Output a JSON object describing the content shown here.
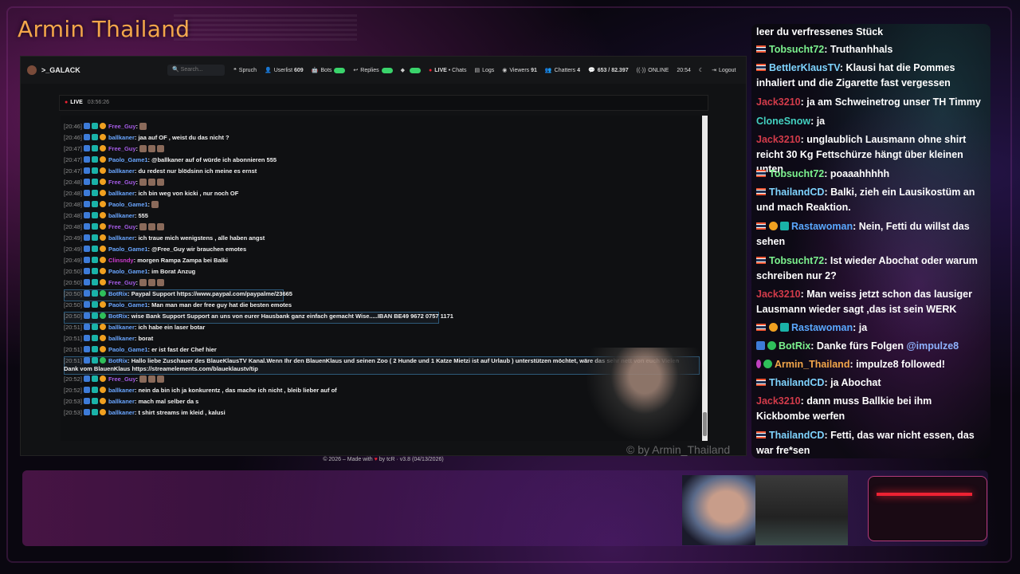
{
  "overlay": {
    "title": "Armin Thailand",
    "watermark": "© by Armin_Thailand"
  },
  "navbar": {
    "brand": ">_GALACK",
    "search_placeholder": "Search...",
    "items": {
      "spruch": "Spruch",
      "userlist": "Userlist",
      "userlist_count": "609",
      "bots": "Bots",
      "replies": "Replies",
      "live": "LIVE",
      "chats": "• Chats",
      "logs": "Logs",
      "viewers": "Viewers",
      "viewers_count": "91",
      "chatters": "Chatters",
      "chatters_count": "4",
      "messages": "653 / 82.397",
      "online": "ONLINE",
      "time": "20:54",
      "logout": "Logout"
    }
  },
  "live_bar": {
    "label": "LIVE",
    "uptime": "03:56:26"
  },
  "chatlog": [
    {
      "ts": "[20:46]",
      "user": "Free_Guy",
      "color": "purple",
      "text": ":",
      "emotes": 1
    },
    {
      "ts": "[20:46]",
      "user": "ballkaner",
      "color": "blue",
      "text": ": jaa auf OF , weist du das nicht ?"
    },
    {
      "ts": "[20:47]",
      "user": "Free_Guy",
      "color": "purple",
      "text": ":",
      "emotes": 3
    },
    {
      "ts": "[20:47]",
      "user": "Paolo_Game1",
      "color": "blue",
      "text": ": @ballkaner auf of würde ich abonnieren 555"
    },
    {
      "ts": "[20:47]",
      "user": "ballkaner",
      "color": "blue",
      "text": ": du redest nur blödsinn ich meine es ernst"
    },
    {
      "ts": "[20:48]",
      "user": "Free_Guy",
      "color": "purple",
      "text": ":",
      "emotes": 3
    },
    {
      "ts": "[20:48]",
      "user": "ballkaner",
      "color": "blue",
      "text": ": ich bin weg von kicki , nur noch OF"
    },
    {
      "ts": "[20:48]",
      "user": "Paolo_Game1",
      "color": "blue",
      "text": ":",
      "emotes": 1
    },
    {
      "ts": "[20:48]",
      "user": "ballkaner",
      "color": "blue",
      "text": ": 555"
    },
    {
      "ts": "[20:48]",
      "user": "Free_Guy",
      "color": "purple",
      "text": ":",
      "emotes": 3
    },
    {
      "ts": "[20:49]",
      "user": "ballkaner",
      "color": "blue",
      "text": ": ich traue mich wenigstens , alle haben angst"
    },
    {
      "ts": "[20:49]",
      "user": "Paolo_Game1",
      "color": "blue",
      "text": ": @Free_Guy wir brauchen emotes"
    },
    {
      "ts": "[20:49]",
      "user": "Clinsndy",
      "color": "pink",
      "text": ": morgen Rampa Zampa bei Balki"
    },
    {
      "ts": "[20:50]",
      "user": "Paolo_Game1",
      "color": "blue",
      "text": ": im Borat Anzug"
    },
    {
      "ts": "[20:50]",
      "user": "Free_Guy",
      "color": "purple",
      "text": ":",
      "emotes": 3
    },
    {
      "ts": "[20:50]",
      "user": "BotRix",
      "color": "blue",
      "text": ": Paypal Support https://www.paypal.com/paypalme/23665",
      "bot": true
    },
    {
      "ts": "[20:50]",
      "user": "Paolo_Game1",
      "color": "blue",
      "text": ": Man man man der free guy hat die besten emotes"
    },
    {
      "ts": "[20:50]",
      "user": "BotRix",
      "color": "blue",
      "text": ": wise Bank Support Support an uns von eurer Hausbank ganz einfach gemacht Wise.....IBAN BE49 9672 0757 1171",
      "bot": true
    },
    {
      "ts": "[20:51]",
      "user": "ballkaner",
      "color": "blue",
      "text": ": ich habe ein laser botar"
    },
    {
      "ts": "[20:51]",
      "user": "ballkaner",
      "color": "blue",
      "text": ": borat"
    },
    {
      "ts": "[20:51]",
      "user": "Paolo_Game1",
      "color": "blue",
      "text": ": er ist fast der Chef hier"
    },
    {
      "ts": "[20:51]",
      "user": "BotRix",
      "color": "blue",
      "text": ": Hallo liebe Zuschauer des BlaueKlausTV Kanal.Wenn Ihr den BlauenKlaus und seinen Zoo ( 2 Hunde und 1 Katze Mietzi ist auf Urlaub ) unterstützen möchtet, wäre das sehr nett von euch Vielen",
      "text2": "Dank vom BlauenKlaus https://streamelements.com/blaueklaustv/tip",
      "bot": true
    },
    {
      "ts": "[20:52]",
      "user": "Free_Guy",
      "color": "purple",
      "text": ":",
      "emotes": 3
    },
    {
      "ts": "[20:52]",
      "user": "ballkaner",
      "color": "blue",
      "text": ": nein da bin ich ja konkurentz , das mache ich nicht , bleib lieber auf of"
    },
    {
      "ts": "[20:53]",
      "user": "ballkaner",
      "color": "blue",
      "text": ": mach mal selber da s"
    },
    {
      "ts": "[20:53]",
      "user": "ballkaner",
      "color": "blue",
      "text": ": t shirt streams im kleid , kalusi"
    }
  ],
  "footer": {
    "pre": "© 2026 – Made with",
    "post": "by tcR · v3.8 (04/13/2026)"
  },
  "side_chat": [
    {
      "user": "",
      "text": "leer du verfressenes Stück"
    },
    {
      "user": "Tobsucht72",
      "color": "green",
      "text": ": Truthanhhals"
    },
    {
      "user": "BettlerKlausTV",
      "color": "cyan",
      "text": ": Klausi hat die Pommes inhaliert und die Zigarette fast vergessen"
    },
    {
      "user": "Jack3210",
      "color": "red",
      "text": ": ja am Schweinetrog unser TH Timmy"
    },
    {
      "user": "CloneSnow",
      "color": "teal",
      "text": ": ja"
    },
    {
      "user": "Jack3210",
      "color": "red",
      "text": ": unglaublich Lausmann ohne shirt reicht 30 Kg Fettschürze hängt über kleinen unten"
    },
    {
      "user": "Tobsucht72",
      "color": "green",
      "text": ": poaaahhhhh"
    },
    {
      "user": "ThailandCD",
      "color": "cyan",
      "text": ": Balki, zieh ein Lausikostüm an und mach Reaktion."
    },
    {
      "user": "Rastawoman",
      "color": "blue",
      "text": ": Nein, Fetti du willst das sehen"
    },
    {
      "user": "Tobsucht72",
      "color": "green",
      "text": ": Ist wieder Abochat oder warum schreiben nur 2?"
    },
    {
      "user": "Jack3210",
      "color": "red",
      "text": ": Man weiss jetzt schon das lausiger Lausmann wieder sagt ,das ist sein WERK"
    },
    {
      "user": "Rastawoman",
      "color": "blue",
      "text": ": ja"
    },
    {
      "user": "BotRix",
      "color": "green",
      "text": ": Danke fürs Folgen ",
      "mention": "@impulze8"
    },
    {
      "user": "Armin_Thailand",
      "color": "orange",
      "text": ": impulze8 followed!"
    },
    {
      "user": "ThailandCD",
      "color": "cyan",
      "text": ": ja Abochat"
    },
    {
      "user": "Jack3210",
      "color": "red",
      "text": ": dann muss Ballkie bei ihm Kickbombe werfen"
    },
    {
      "user": "ThailandCD",
      "color": "cyan",
      "text": ": Fetti, das war nicht essen, das war fre*sen"
    }
  ],
  "colors": {
    "title": "#f3a64a",
    "live": "#ee2233",
    "toggle": "#3ad36b",
    "accent_purple": "#a55be6"
  }
}
